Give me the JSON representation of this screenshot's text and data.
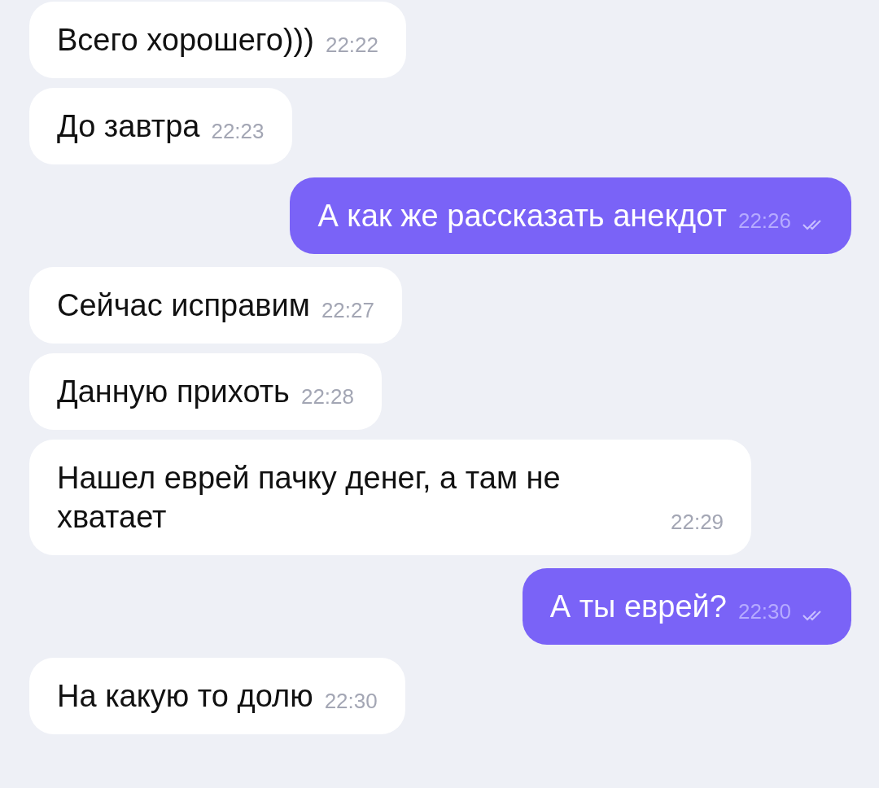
{
  "messages": [
    {
      "text": "Всего хорошего)))",
      "time": "22:22",
      "outgoing": false
    },
    {
      "text": "До завтра",
      "time": "22:23",
      "outgoing": false
    },
    {
      "text": "А как же рассказать анекдот",
      "time": "22:26",
      "outgoing": true,
      "read": true
    },
    {
      "text": "Сейчас исправим",
      "time": "22:27",
      "outgoing": false
    },
    {
      "text": "Данную прихоть",
      "time": "22:28",
      "outgoing": false
    },
    {
      "text": "Нашел еврей пачку денег, а там не хватает",
      "time": "22:29",
      "outgoing": false
    },
    {
      "text": "А ты еврей?",
      "time": "22:30",
      "outgoing": true,
      "read": true
    },
    {
      "text": "На какую то долю",
      "time": "22:30",
      "outgoing": false
    }
  ]
}
